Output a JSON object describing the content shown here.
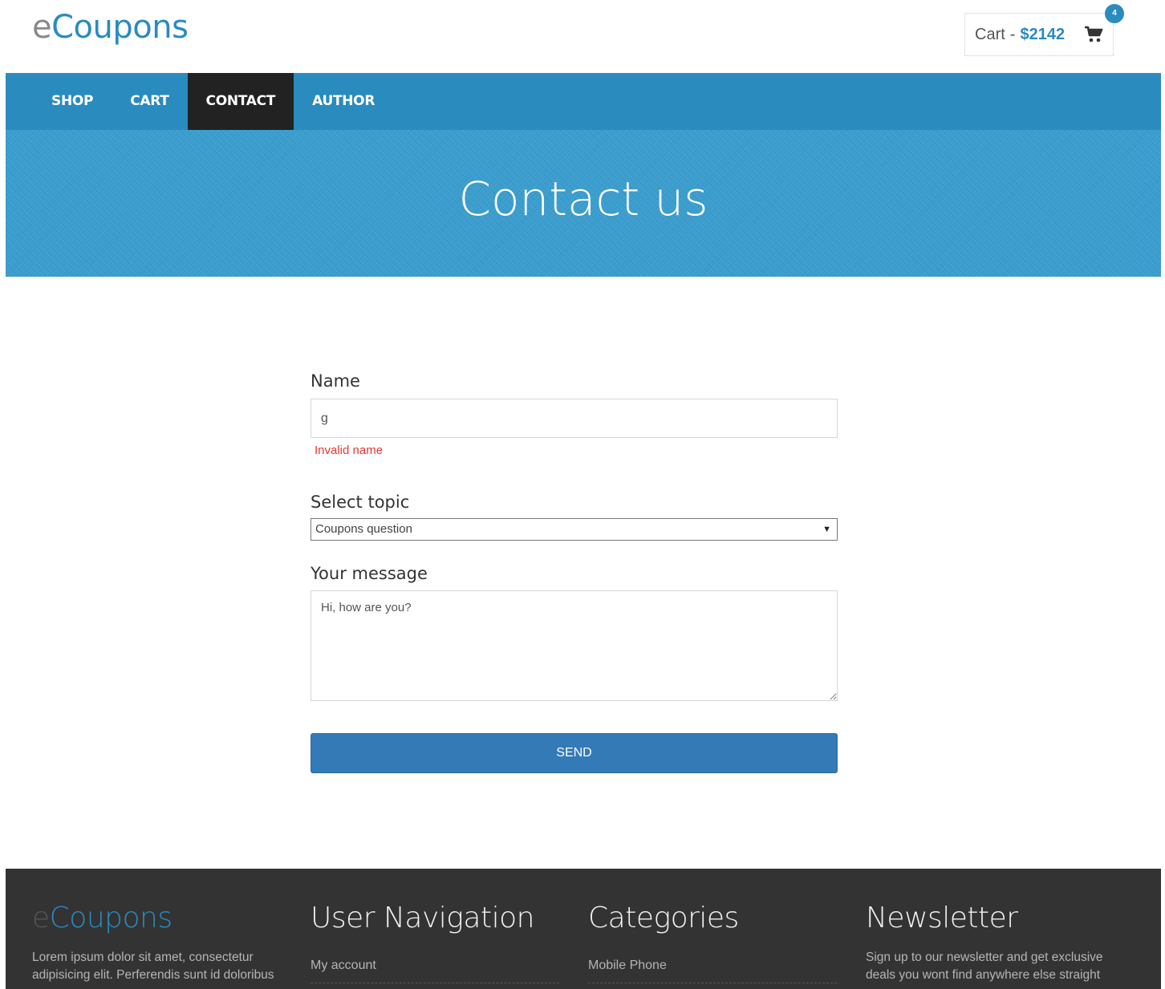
{
  "header": {
    "brand_prefix": "e",
    "brand_suffix": "Coupons",
    "cart_label": "Cart",
    "cart_separator": "-",
    "cart_total": "$2142",
    "cart_count": "4"
  },
  "nav": {
    "items": [
      {
        "label": "SHOP"
      },
      {
        "label": "CART"
      },
      {
        "label": "CONTACT"
      },
      {
        "label": "AUTHOR"
      }
    ],
    "active": "CONTACT"
  },
  "hero": {
    "title": "Contact us"
  },
  "form": {
    "name_label": "Name",
    "name_value": "g",
    "name_error": "Invalid name",
    "topic_label": "Select topic",
    "topic_selected": "Coupons question",
    "message_label": "Your message",
    "message_value": "Hi, how are you?",
    "send_label": "SEND"
  },
  "footer": {
    "brand_prefix": "e",
    "brand_suffix": "Coupons",
    "about_text": "Lorem ipsum dolor sit amet, consectetur adipisicing elit. Perferendis sunt id doloribus",
    "user_nav_heading": "User Navigation",
    "user_nav_link": "My account",
    "categories_heading": "Categories",
    "categories_link": "Mobile Phone",
    "newsletter_heading": "Newsletter",
    "newsletter_text": "Sign up to our newsletter and get exclusive deals you wont find anywhere else straight"
  },
  "colors": {
    "brand_blue": "#2a8bbf",
    "nav_active": "#222222",
    "button_blue": "#337ab7",
    "error_red": "#e53935",
    "footer_bg": "#333333"
  },
  "icons": {
    "cart": "shopping-cart-icon",
    "select_arrow": "chevron-down-icon"
  }
}
